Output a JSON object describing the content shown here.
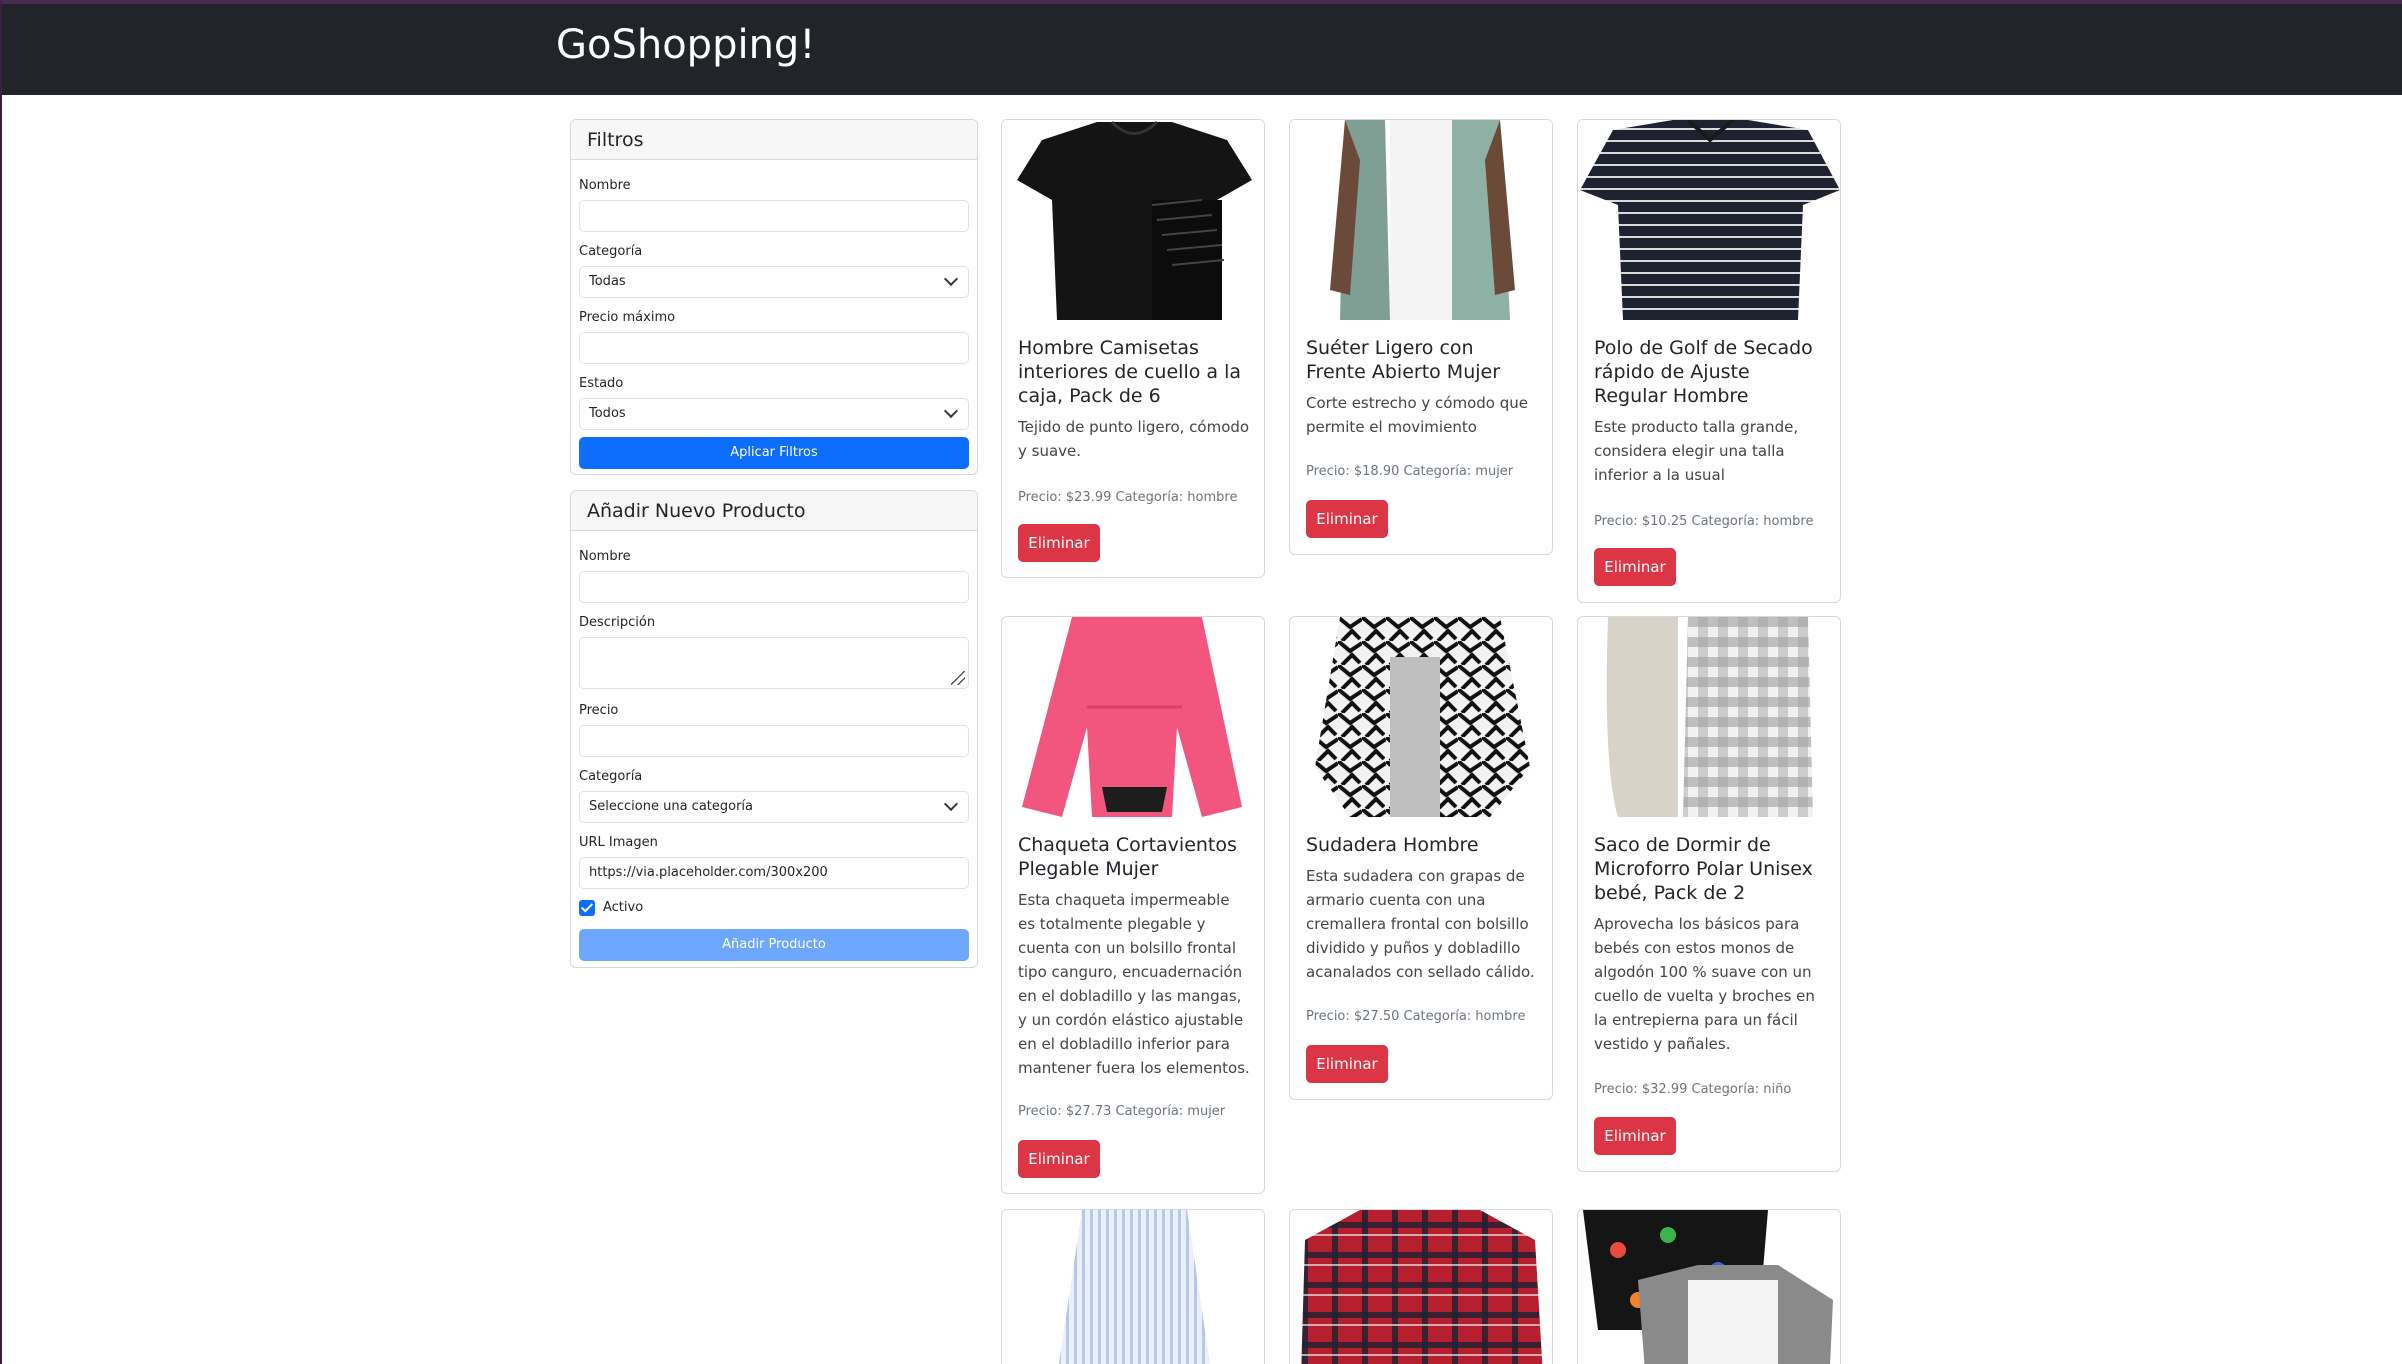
{
  "navbar": {
    "brand": "GoShopping!"
  },
  "filters": {
    "title": "Filtros",
    "name_label": "Nombre",
    "name_value": "",
    "category_label": "Categoría",
    "category_value": "Todas",
    "max_price_label": "Precio máximo",
    "max_price_value": "",
    "status_label": "Estado",
    "status_value": "Todos",
    "apply_button": "Aplicar Filtros"
  },
  "new_product": {
    "title": "Añadir Nuevo Producto",
    "name_label": "Nombre",
    "description_label": "Descripción",
    "price_label": "Precio",
    "category_label": "Categoría",
    "category_value": "Seleccione una categoría",
    "image_url_label": "URL Imagen",
    "image_url_value": "https://via.placeholder.com/300x200",
    "active_label": "Activo",
    "active_checked": true,
    "add_button": "Añadir Producto"
  },
  "delete_label": "Eliminar",
  "products": [
    {
      "title": "Hombre Camisetas interiores de cuello a la caja, Pack de 6",
      "description": "Tejido de punto ligero, cómodo y suave.",
      "meta": "Precio: $23.99 Categoría: hombre",
      "image": "black-tshirt-pack"
    },
    {
      "title": "Suéter Ligero con Frente Abierto Mujer",
      "description": "Corte estrecho y cómodo que permite el movimiento",
      "meta": "Precio: $18.90 Categoría: mujer",
      "image": "sage-cardigan"
    },
    {
      "title": "Polo de Golf de Secado rápido de Ajuste Regular Hombre",
      "description": "Este producto talla grande, considera elegir una talla inferior a la usual",
      "meta": "Precio: $10.25 Categoría: hombre",
      "image": "striped-polo"
    },
    {
      "title": "Chaqueta Cortavientos Plegable Mujer",
      "description": "Esta chaqueta impermeable es totalmente plegable y cuenta con un bolsillo frontal tipo canguro, encuadernación en el dobladillo y las mangas, y un cordón elástico ajustable en el dobladillo inferior para mantener fuera los elementos.",
      "meta": "Precio: $27.73 Categoría: mujer",
      "image": "pink-windbreaker"
    },
    {
      "title": "Sudadera Hombre",
      "description": "Esta sudadera con grapas de armario cuenta con una cremallera frontal con bolsillo dividido y puños y dobladillo acanalados con sellado cálido.",
      "meta": "Precio: $27.50 Categoría: hombre",
      "image": "comic-hoodie"
    },
    {
      "title": "Saco de Dormir de Microforro Polar Unisex bebé, Pack de 2",
      "description": "Aprovecha los básicos para bebés con estos monos de algodón 100 % suave con un cuello de vuelta y broches en la entrepierna para un fácil vestido y pañales.",
      "meta": "Precio: $32.99 Categoría: niño",
      "image": "baby-sleep-sacks"
    },
    {
      "title": "",
      "description": "",
      "meta": "",
      "image": "blue-striped-shirt"
    },
    {
      "title": "",
      "description": "",
      "meta": "",
      "image": "red-plaid-shirt"
    },
    {
      "title": "",
      "description": "",
      "meta": "",
      "image": "dino-kids-tees"
    }
  ]
}
